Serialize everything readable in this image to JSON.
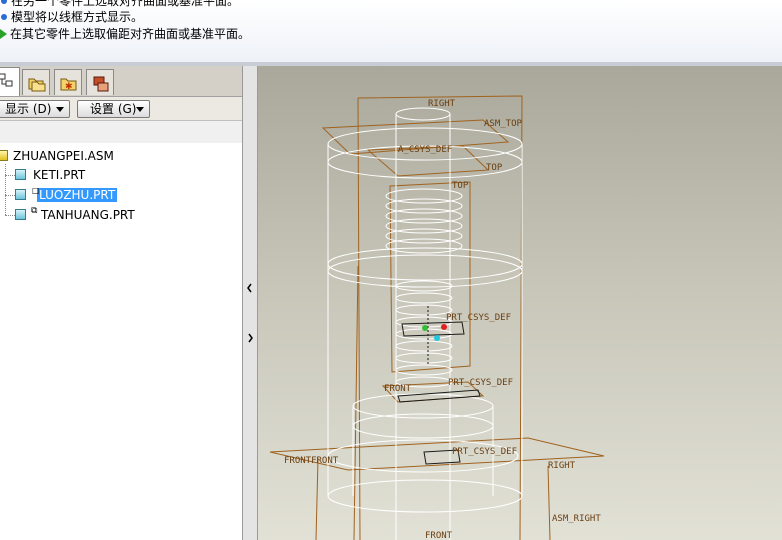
{
  "messages": [
    {
      "icon": "info-dot-icon",
      "text": "在另一个零件上选取对齐曲面或基准平面。"
    },
    {
      "icon": "info-dot-icon",
      "text": "模型将以线框方式显示。"
    },
    {
      "icon": "green-arrow-icon",
      "text": "在其它零件上选取偏距对齐曲面或基准平面。"
    }
  ],
  "toolbar": {
    "display_label": "显示 (D)",
    "settings_label": "设置 (G)"
  },
  "tree": {
    "root": "ZHUANGPEI.ASM",
    "items": [
      {
        "label": "KETI.PRT",
        "selected": false
      },
      {
        "label": "LUOZHU.PRT",
        "selected": true
      },
      {
        "label": "TANHUANG.PRT",
        "selected": false
      }
    ]
  },
  "datum_labels": {
    "right_top": "RIGHT",
    "asm_top": "ASM_TOP",
    "asm_def": "A_CSYS_DEF",
    "top_1": "TOP",
    "top_2": "TOP",
    "prt_csys_1": "PRT_CSYS_DEF",
    "prt_csys_2": "PRT_CSYS_DEF",
    "prt_csys_3": "PRT_CSYS_DEF",
    "front_1": "FRONT",
    "front_2": "FRONTFRONT",
    "front_3": "FRONT",
    "right_bottom": "RIGHT",
    "asm_right": "ASM_RIGHT"
  },
  "colors": {
    "selection": "#3399ff",
    "datum": "#a0621e",
    "wireframe": "#ffffff",
    "prompt_arrow": "#29a329"
  }
}
